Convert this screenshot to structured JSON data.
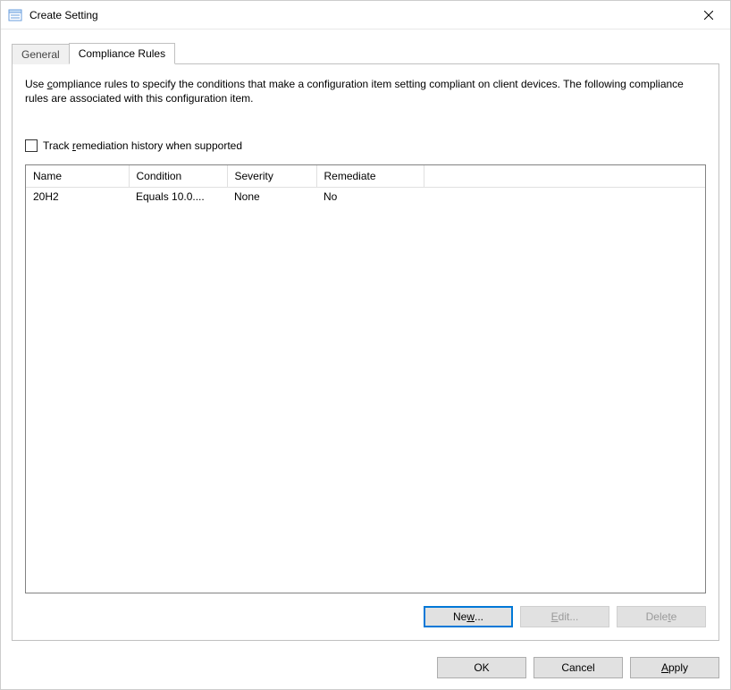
{
  "window": {
    "title": "Create Setting"
  },
  "tabs": {
    "general": "General",
    "compliance": "Compliance Rules"
  },
  "panel": {
    "description": "Use compliance rules to specify the conditions that make a configuration item setting compliant on client devices. The following compliance rules are associated with this configuration item.",
    "track_checkbox_pre": "Track ",
    "track_checkbox_u": "r",
    "track_checkbox_post": "emediation history when supported"
  },
  "table": {
    "headers": {
      "name": "Name",
      "condition": "Condition",
      "severity": "Severity",
      "remediate": "Remediate"
    },
    "rows": [
      {
        "name": "20H2",
        "condition": "Equals 10.0....",
        "severity": "None",
        "remediate": "No"
      }
    ]
  },
  "panel_buttons": {
    "new_pre": "Ne",
    "new_u": "w",
    "new_post": "...",
    "edit_u": "E",
    "edit_post": "dit...",
    "delete_pre": "Dele",
    "delete_u": "t",
    "delete_post": "e"
  },
  "dialog_buttons": {
    "ok": "OK",
    "cancel": "Cancel",
    "apply_u": "A",
    "apply_post": "pply"
  }
}
